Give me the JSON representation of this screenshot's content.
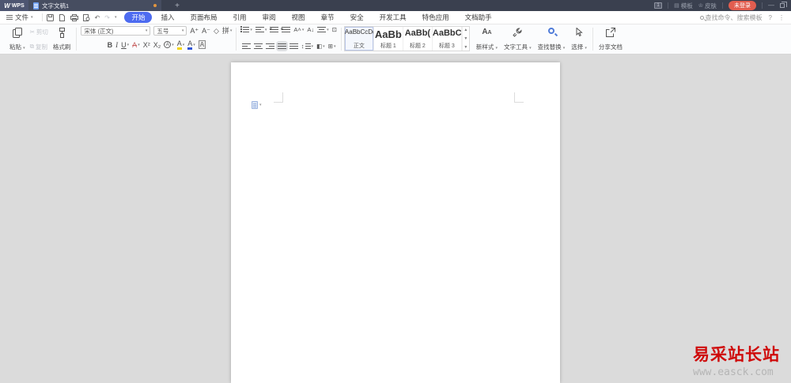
{
  "titlebar": {
    "app_name": "WPS",
    "tab_title": "文字文稿1",
    "new_tab_label": "+",
    "window_badge": "1",
    "template_label": "模板",
    "skin_label": "皮肤",
    "login_label": "未登录"
  },
  "menubar": {
    "file_label": "文件",
    "tabs": [
      {
        "label": "开始"
      },
      {
        "label": "插入"
      },
      {
        "label": "页面布局"
      },
      {
        "label": "引用"
      },
      {
        "label": "审阅"
      },
      {
        "label": "视图"
      },
      {
        "label": "章节"
      },
      {
        "label": "安全"
      },
      {
        "label": "开发工具"
      },
      {
        "label": "特色应用"
      },
      {
        "label": "文档助手"
      }
    ],
    "active_tab": "开始",
    "search_placeholder": "查找命令、搜索模板",
    "help_label": "?"
  },
  "toolbar": {
    "paste_label": "粘贴",
    "cut_label": "剪切",
    "copy_label": "复制",
    "format_painter_label": "格式刷",
    "font_name": "宋体 (正文)",
    "font_size": "五号",
    "bold_label": "B",
    "italic_label": "I",
    "underline_label": "U",
    "strike_label": "A",
    "superscript_label": "X²",
    "subscript_label": "X₂",
    "circle_char_label": "A",
    "highlight_label": "A",
    "font_color_label": "A",
    "char_shading_label": "A",
    "pinyin_label": "拼",
    "grow_font_label": "A⁺",
    "shrink_font_label": "A⁻",
    "clear_format_label": "◇",
    "sort_label": "A↓",
    "char_scale_label": "A˄",
    "shading_label": "◧",
    "borders_label": "⊞",
    "line_spacing_label": "↕",
    "styles": [
      {
        "sample": "AaBbCcDd",
        "label": "正文"
      },
      {
        "sample": "AaBb",
        "label": "标题 1"
      },
      {
        "sample": "AaBb(",
        "label": "标题 2"
      },
      {
        "sample": "AaBbC(",
        "label": "标题 3"
      }
    ],
    "new_style_label": "新样式",
    "text_tool_label": "文字工具",
    "find_replace_label": "查找替换",
    "select_label": "选择",
    "share_label": "分享文档"
  },
  "watermark": {
    "title": "易采站长站",
    "url": "www.easck.com"
  },
  "colors": {
    "accent_blue": "#4d6bf0",
    "login_red": "#e25d4f",
    "watermark_red": "#cf0a0a",
    "highlight_yellow": "#f5d60e"
  }
}
